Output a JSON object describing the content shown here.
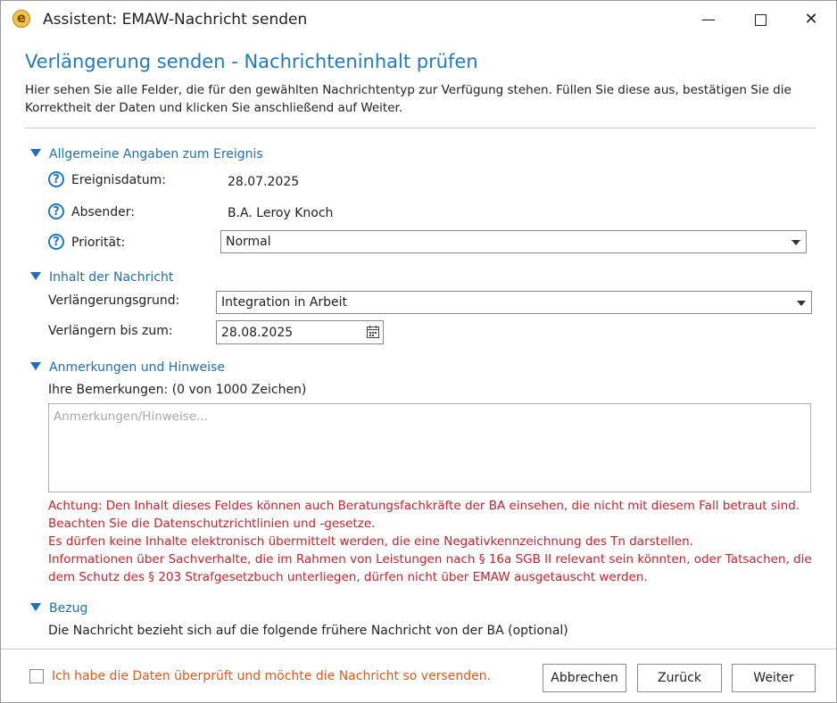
{
  "window": {
    "title": "Assistent: EMAW-Nachricht senden",
    "app_icon_letter": "e",
    "minimize": "—",
    "close": "✕"
  },
  "page": {
    "title": "Verlängerung senden - Nachrichteninhalt prüfen",
    "description_line1": "Hier sehen Sie alle Felder, die für den gewählten Nachrichtentyp zur Verfügung stehen. Füllen Sie diese aus, bestätigen Sie die",
    "description_line2": "Korrektheit der Daten und klicken Sie anschließend auf Weiter."
  },
  "section_general": {
    "title": "Allgemeine Angaben zum Ereignis",
    "date_label": "Ereignisdatum:",
    "date_value": "28.07.2025",
    "sender_label": "Absender:",
    "sender_value": "B.A. Leroy Knoch",
    "priority_label": "Priorität:",
    "priority_value": "Normal"
  },
  "section_content": {
    "title": "Inhalt der Nachricht",
    "reason_label": "Verlängerungsgrund:",
    "reason_value": "Integration in Arbeit",
    "until_label": "Verlängern bis zum:",
    "until_value": "28.08.2025"
  },
  "section_notes": {
    "title": "Anmerkungen und Hinweise",
    "remarks_label": "Ihre Bemerkungen: (0 von 1000 Zeichen)",
    "placeholder": "Anmerkungen/Hinweise...",
    "warning_lines": [
      "Achtung: Den Inhalt dieses Feldes können auch Beratungsfachkräfte der BA einsehen, die nicht mit diesem Fall betraut sind.",
      "Beachten Sie die Datenschutzrichtlinien und -gesetze.",
      "Es dürfen keine Inhalte elektronisch übermittelt werden, die eine Negativkennzeichnung des Tn darstellen.",
      "Informationen über Sachverhalte, die im Rahmen von Leistungen nach § 16a SGB II relevant sein könnten, oder Tatsachen, die",
      "dem Schutz des § 203 Strafgesetzbuch unterliegen, dürfen nicht über EMAW ausgetauscht werden."
    ]
  },
  "section_reference": {
    "title": "Bezug",
    "text": "Die Nachricht bezieht sich auf die folgende frühere Nachricht von der BA (optional)"
  },
  "footer": {
    "confirm_label": "Ich habe die Daten überprüft und möchte die Nachricht so versenden.",
    "cancel": "Abbrechen",
    "back": "Zurück",
    "next": "Weiter"
  },
  "colors": {
    "accent": "#1f7ac4",
    "warning": "#d0202a",
    "confirm": "#e05a1a"
  }
}
